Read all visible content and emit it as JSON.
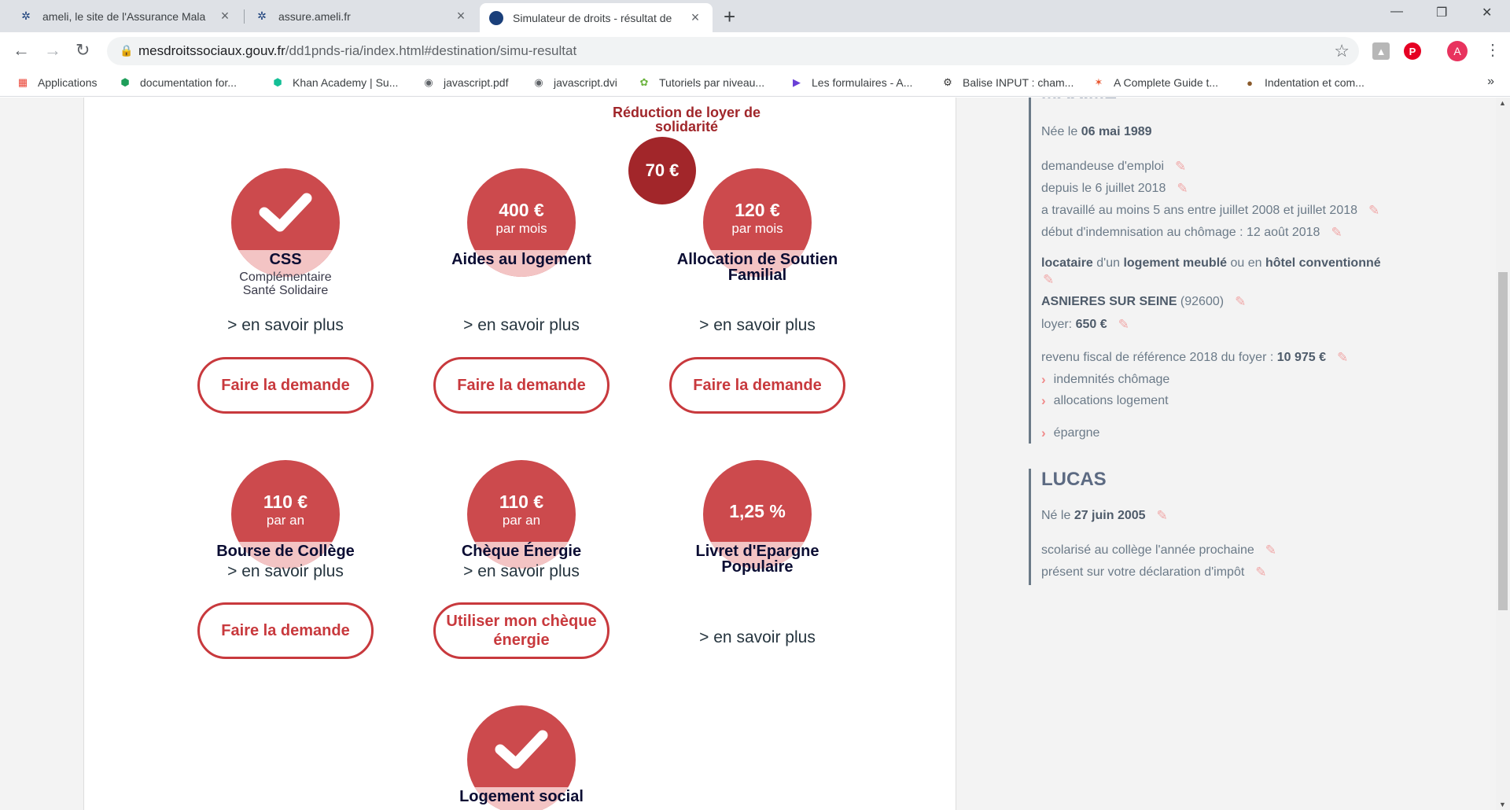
{
  "browser": {
    "tabs": [
      {
        "title": "ameli, le site de l'Assurance Mala",
        "icon": "ameli-icon"
      },
      {
        "title": "assure.ameli.fr",
        "icon": "ameli-icon"
      },
      {
        "title": "Simulateur de droits - résultat de",
        "icon": "globe-icon"
      }
    ],
    "url_host": "mesdroitssociaux.gouv.fr",
    "url_path": "/dd1pnds-ria/index.html#destination/simu-resultat",
    "avatar_letter": "A",
    "bookmarks": [
      "Applications",
      "documentation for...",
      "Khan Academy | Su...",
      "javascript.pdf",
      "javascript.dvi",
      "Tutoriels par niveau...",
      "Les formulaires - A...",
      "Balise INPUT : cham...",
      "A Complete Guide t...",
      "Indentation et com..."
    ]
  },
  "rls": {
    "label": "Réduction de loyer de solidarité",
    "amount": "70 €"
  },
  "benefits": {
    "css": {
      "name": "CSS",
      "subtitle": "Complémentaire Santé Solidaire",
      "more": "> en savoir plus",
      "cta": "Faire la demande"
    },
    "aides_logement": {
      "amount": "400 €",
      "unit": "par mois",
      "name": "Aides au logement",
      "more": "> en savoir plus",
      "cta": "Faire la demande"
    },
    "asf": {
      "amount": "120 €",
      "unit": "par mois",
      "name": "Allocation de Soutien Familial",
      "more": "> en savoir plus",
      "cta": "Faire la demande"
    },
    "bourse": {
      "amount": "110 €",
      "unit": "par an",
      "name": "Bourse de Collège",
      "more": "> en savoir plus",
      "cta": "Faire la demande"
    },
    "cheque": {
      "amount": "110 €",
      "unit": "par an",
      "name": "Chèque Énergie",
      "more": "> en savoir plus",
      "cta": "Utiliser mon chèque énergie"
    },
    "lep": {
      "amount": "1,25 %",
      "name": "Livret d'Epargne Populaire",
      "more": "> en savoir plus"
    },
    "logement_social": {
      "name": "Logement social"
    }
  },
  "profile": {
    "partial_name": "MAXIME",
    "birth_prefix": "Née le",
    "birth_date": "06 mai 1989",
    "status": "demandeuse d'emploi",
    "since": "depuis le 6 juillet 2018",
    "worked": "a travaillé au moins 5 ans entre juillet 2008 et juillet 2018",
    "indemn_start": "début d'indemnisation au chômage : 12 août 2018",
    "housing_a": "locataire",
    "housing_b": " d'un ",
    "housing_c": "logement meublé",
    "housing_d": " ou en ",
    "housing_e": "hôtel conventionné",
    "city": "ASNIERES SUR SEINE",
    "postcode": " (92600)",
    "rent_label": "loyer: ",
    "rent_value": "650 €",
    "income_label": "revenu fiscal de référence 2018 du foyer : ",
    "income_value": "10 975 €",
    "income_items": [
      "indemnités chômage",
      "allocations logement"
    ],
    "savings": "épargne"
  },
  "child": {
    "name": "LUCAS",
    "birth_prefix": "Né le",
    "birth_date": "27 juin 2005",
    "school": "scolarisé au collège l'année prochaine",
    "declared": "présent sur votre déclaration d'impôt"
  },
  "colors": {
    "accent": "#cc4a4d",
    "accent_light": "#f3c4c4",
    "dark_red": "#a2262a"
  }
}
